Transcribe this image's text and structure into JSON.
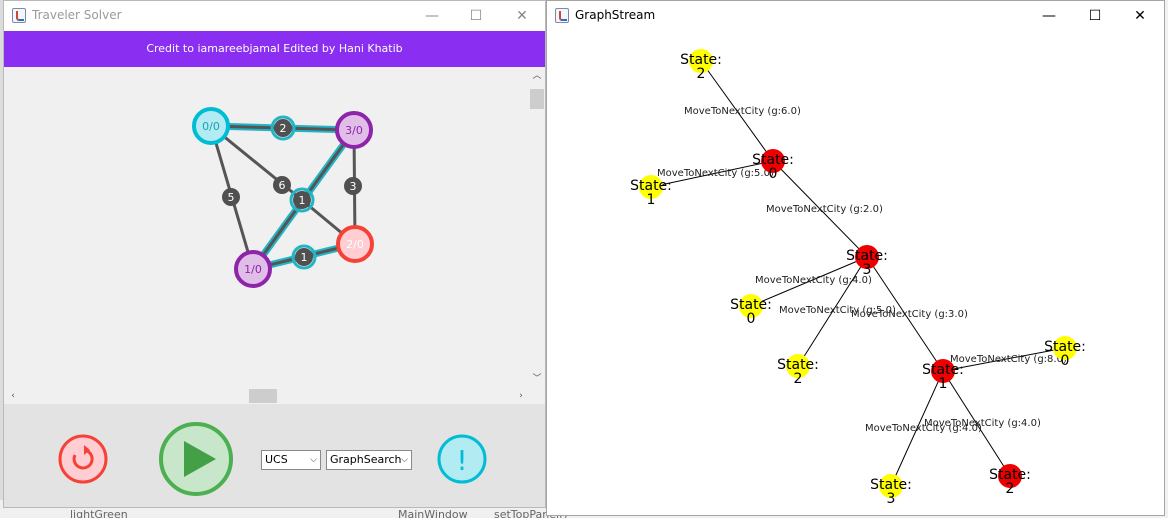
{
  "traveler_solver": {
    "window_title": "Traveler Solver",
    "minimize": "—",
    "maximize": "☐",
    "close": "✕",
    "credit_banner": "Credit to iamareebjamal Edited by Hani Khatib",
    "graph": {
      "nodes": [
        {
          "id": "n0",
          "label": "0/0",
          "fill": "#b2ebf2",
          "stroke": "#00bcd4",
          "text_color": "#1ba1b4"
        },
        {
          "id": "n3",
          "label": "3/0",
          "fill": "#e1bee7",
          "stroke": "#8e24aa",
          "text_color": "#8e24aa"
        },
        {
          "id": "n2",
          "label": "2/0",
          "fill": "#ffcdd2",
          "stroke": "#f44336",
          "text_color": "#ffffff"
        },
        {
          "id": "n1",
          "label": "1/0",
          "fill": "#e1bee7",
          "stroke": "#8e24aa",
          "text_color": "#8e24aa"
        }
      ],
      "edges": [
        {
          "from": "n0",
          "to": "n3",
          "weight": "2",
          "highlighted": true
        },
        {
          "from": "n0",
          "to": "mid",
          "weight": "6",
          "highlighted": false
        },
        {
          "from": "n0",
          "to": "n1",
          "weight": "5",
          "highlighted": false
        },
        {
          "from": "n3",
          "to": "n2",
          "weight": "3",
          "highlighted": false
        },
        {
          "from": "n3",
          "to": "n1",
          "weight": "1",
          "highlighted": true
        },
        {
          "from": "n1",
          "to": "n2",
          "weight": "1",
          "highlighted": true
        }
      ],
      "highlight_color": "#22b5c6",
      "edge_color": "#555555"
    },
    "controls": {
      "reset_icon": "reset-icon",
      "play_icon": "play-icon",
      "algorithm_select": "UCS",
      "search_type_select": "GraphSearch",
      "info_icon": "!",
      "colors": {
        "reset": "#f44336",
        "play": "#4caf50",
        "info": "#00bcd4"
      }
    }
  },
  "graphstream": {
    "window_title": "GraphStream",
    "minimize": "—",
    "maximize": "☐",
    "close": "✕",
    "node_colors": {
      "visited": "#ee0000",
      "frontier": "#ffff00"
    },
    "tree": {
      "nodes": [
        {
          "id": "s2a",
          "state_label": "State:",
          "value": "2",
          "kind": "frontier"
        },
        {
          "id": "s0a",
          "state_label": "State:",
          "value": "0",
          "kind": "visited"
        },
        {
          "id": "s1a",
          "state_label": "State:",
          "value": "1",
          "kind": "frontier"
        },
        {
          "id": "s3a",
          "state_label": "State:",
          "value": "3",
          "kind": "visited"
        },
        {
          "id": "s0b",
          "state_label": "State:",
          "value": "0",
          "kind": "frontier"
        },
        {
          "id": "s2b",
          "state_label": "State:",
          "value": "2",
          "kind": "frontier"
        },
        {
          "id": "s1b",
          "state_label": "State:",
          "value": "1",
          "kind": "visited"
        },
        {
          "id": "s0c",
          "state_label": "State:",
          "value": "0",
          "kind": "frontier"
        },
        {
          "id": "s3b",
          "state_label": "State:",
          "value": "3",
          "kind": "frontier"
        },
        {
          "id": "s2c",
          "state_label": "State:",
          "value": "2",
          "kind": "visited"
        }
      ],
      "edges": [
        {
          "from": "s2a",
          "to": "s0a",
          "label": "MoveToNextCity (g:6.0)"
        },
        {
          "from": "s1a",
          "to": "s0a",
          "label": "MoveToNextCity (g:5.0)"
        },
        {
          "from": "s0a",
          "to": "s3a",
          "label": "MoveToNextCity (g:2.0)"
        },
        {
          "from": "s3a",
          "to": "s0b",
          "label": "MoveToNextCity (g:4.0)"
        },
        {
          "from": "s3a",
          "to": "s2b",
          "label": "MoveToNextCity (g:5.0)"
        },
        {
          "from": "s3a",
          "to": "s1b",
          "label": "MoveToNextCity (g:3.0)"
        },
        {
          "from": "s1b",
          "to": "s0c",
          "label": "MoveToNextCity (g:8.0)"
        },
        {
          "from": "s1b",
          "to": "s3b",
          "label": "MoveToNextCity (g:4.0)"
        },
        {
          "from": "s1b",
          "to": "s2c",
          "label": "MoveToNextCity (g:4.0)"
        }
      ]
    }
  },
  "background": {
    "code_breadcrumb_1": "MainWindow",
    "code_breadcrumb_2": "setTopPanel()",
    "tree_item": "lightGreen"
  }
}
